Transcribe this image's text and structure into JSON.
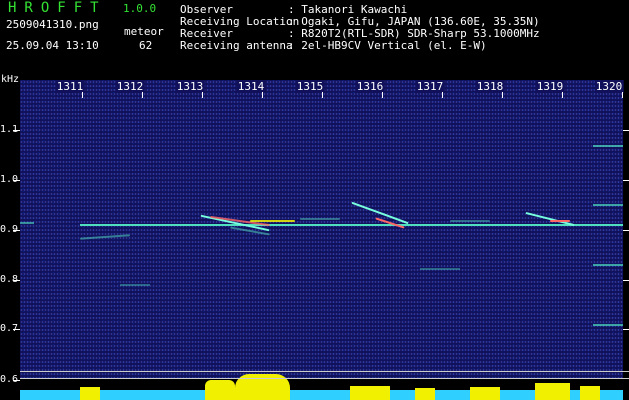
{
  "app": {
    "title": "HROFFT",
    "version": "1.0.0"
  },
  "capture": {
    "filename": "2509041310.png",
    "datetime": "25.09.04 13:10",
    "kind_label": "meteor",
    "count": "62"
  },
  "meta": [
    {
      "key": "Observer",
      "value": ": Takanori Kawachi"
    },
    {
      "key": "Receiving Location",
      "value": ": Ogaki, Gifu, JAPAN (136.60E, 35.35N)"
    },
    {
      "key": "Receiver",
      "value": ": R820T2(RTL-SDR) SDR-Sharp 53.1000MHz"
    },
    {
      "key": "Receiving antenna",
      "value": ": 2el-HB9CV Vertical (el. E-W)"
    }
  ],
  "axes": {
    "y_unit": "kHz",
    "y_ticks": [
      "1.1",
      "1.0",
      "0.9",
      "0.8",
      "0.7",
      "0.6"
    ],
    "x_ticks": [
      "1311",
      "1312",
      "1313",
      "1314",
      "1315",
      "1316",
      "1317",
      "1318",
      "1319",
      "1320"
    ]
  },
  "colors": {
    "background": "#000000",
    "spectrogram_bg": "#10115a",
    "title_green": "#34e234",
    "signal": "#4fe0c0",
    "level_yellow": "#f0f000",
    "level_cyan": "#2fd0ff"
  }
}
